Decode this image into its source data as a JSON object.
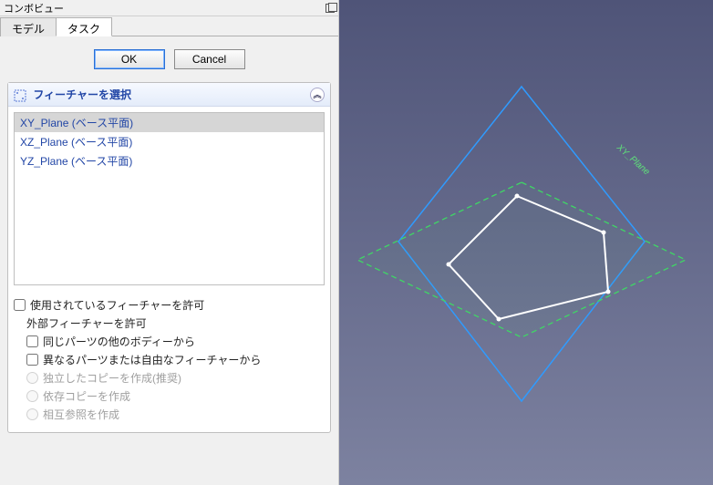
{
  "panel": {
    "title": "コンボビュー"
  },
  "tabs": {
    "model": "モデル",
    "task": "タスク",
    "active": "task"
  },
  "buttons": {
    "ok": "OK",
    "cancel": "Cancel"
  },
  "section": {
    "title": "フィーチャーを選択"
  },
  "features": {
    "items": [
      {
        "label": "XY_Plane (ベース平面)",
        "selected": true
      },
      {
        "label": "XZ_Plane (ベース平面)",
        "selected": false
      },
      {
        "label": "YZ_Plane (ベース平面)",
        "selected": false
      }
    ]
  },
  "options": {
    "allow_used": "使用されているフィーチャーを許可",
    "allow_external_header": "外部フィーチャーを許可",
    "from_other_bodies": "同じパーツの他のボディーから",
    "from_different_parts": "異なるパーツまたは自由なフィーチャーから",
    "copy_independent": "独立したコピーを作成(推奨)",
    "copy_dependent": "依存コピーを作成",
    "cross_reference": "相互参照を作成"
  },
  "viewport": {
    "plane_label": "XY_Plane"
  },
  "colors": {
    "xz": "#2f9bff",
    "yz_fill": "rgba(100,200,120,0.08)",
    "yz_stroke": "#3fd765",
    "xy": "#ffffff",
    "sketch": "#ffffff"
  }
}
